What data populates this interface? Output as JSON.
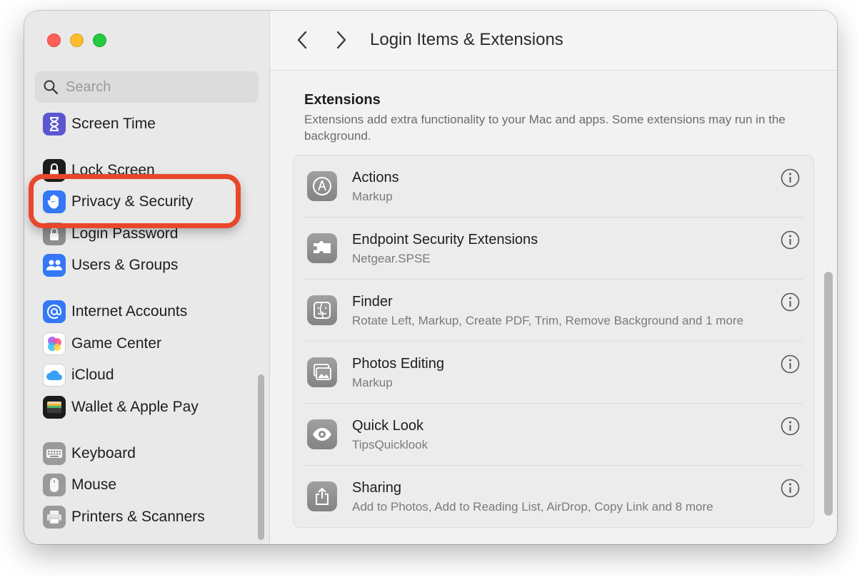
{
  "sidebar": {
    "search_placeholder": "Search",
    "items": [
      {
        "label": "Screen Time",
        "icon": "hourglass-icon",
        "color": "#5b57d1"
      },
      {
        "label": "Lock Screen",
        "icon": "lock-icon",
        "color": "#1c1c1c"
      },
      {
        "label": "Privacy & Security",
        "icon": "hand-icon",
        "color": "#3478f6"
      },
      {
        "label": "Login Password",
        "icon": "key-lock-icon",
        "color": "#8e8e8e"
      },
      {
        "label": "Users & Groups",
        "icon": "users-icon",
        "color": "#3478f6"
      },
      {
        "label": "Internet Accounts",
        "icon": "at-icon",
        "color": "#3478f6"
      },
      {
        "label": "Game Center",
        "icon": "game-center-icon",
        "color": "#ffffff"
      },
      {
        "label": "iCloud",
        "icon": "cloud-icon",
        "color": "#ffffff"
      },
      {
        "label": "Wallet & Apple Pay",
        "icon": "wallet-icon",
        "color": "#1c1c1c"
      },
      {
        "label": "Keyboard",
        "icon": "keyboard-icon",
        "color": "#9a9a9a"
      },
      {
        "label": "Mouse",
        "icon": "mouse-icon",
        "color": "#9a9a9a"
      },
      {
        "label": "Printers & Scanners",
        "icon": "printer-icon",
        "color": "#9a9a9a"
      }
    ],
    "highlighted": "Privacy & Security",
    "highlight_color": "#e8472b"
  },
  "toolbar": {
    "title": "Login Items & Extensions"
  },
  "extensions": {
    "title": "Extensions",
    "description": "Extensions add extra functionality to your Mac and apps. Some extensions may run in the background.",
    "rows": [
      {
        "name": "Actions",
        "detail": "Markup",
        "icon": "actions-icon"
      },
      {
        "name": "Endpoint Security Extensions",
        "detail": "Netgear.SPSE",
        "icon": "puzzle-icon"
      },
      {
        "name": "Finder",
        "detail": "Rotate Left, Markup, Create PDF, Trim, Remove Background and 1 more",
        "icon": "finder-icon"
      },
      {
        "name": "Photos Editing",
        "detail": "Markup",
        "icon": "photos-icon"
      },
      {
        "name": "Quick Look",
        "detail": "TipsQuicklook",
        "icon": "eye-icon"
      },
      {
        "name": "Sharing",
        "detail": "Add to Photos, Add to Reading List, AirDrop, Copy Link and 8 more",
        "icon": "share-icon"
      }
    ]
  }
}
